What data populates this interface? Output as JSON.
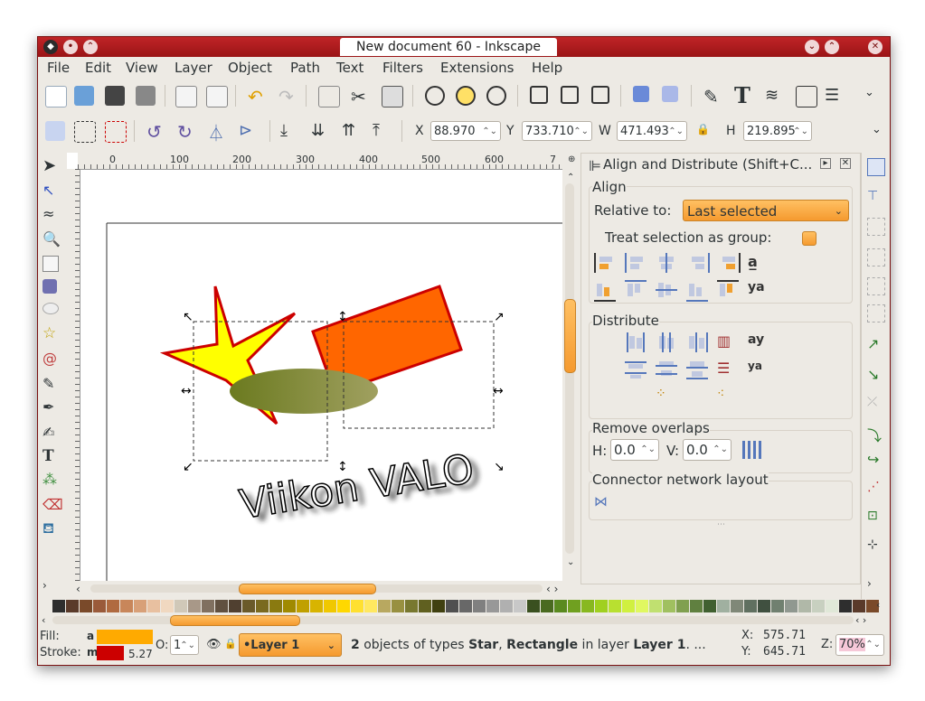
{
  "window": {
    "title": "New document 60 - Inkscape"
  },
  "menu": [
    "File",
    "Edit",
    "View",
    "Layer",
    "Object",
    "Path",
    "Text",
    "Filters",
    "Extensions",
    "Help"
  ],
  "coords_toolbar": {
    "x_label": "X",
    "x_value": "88.970",
    "y_label": "Y",
    "y_value": "733.710",
    "w_label": "W",
    "w_value": "471.493",
    "h_label": "H",
    "h_value": "219.895"
  },
  "ruler": {
    "ticks": [
      "0",
      "100",
      "200",
      "300",
      "400",
      "500",
      "600",
      "7"
    ]
  },
  "canvas": {
    "text_object": "Viikon VALO"
  },
  "dock": {
    "title": "Align and Distribute (Shift+C...",
    "align_header": "Align",
    "relative_label": "Relative to:",
    "relative_value": "Last selected",
    "treat_group_label": "Treat selection as group:",
    "distribute_header": "Distribute",
    "remove_overlaps_header": "Remove overlaps",
    "h_label": "H:",
    "h_value": "0.0",
    "v_label": "V:",
    "v_value": "0.0",
    "connector_header": "Connector network layout"
  },
  "status": {
    "fill_label": "Fill:",
    "fill_value": "a",
    "fill_color": "#ffaa00",
    "stroke_label": "Stroke:",
    "stroke_value": "m",
    "stroke_color": "#cc0000",
    "stroke_width": "5.27",
    "opacity_label": "O:",
    "opacity_value": "1",
    "layer_value": "•Layer 1",
    "message_count": "2",
    "message_part1": " objects of types ",
    "message_type1": "Star",
    "message_part2": ", ",
    "message_type2": "Rectangle",
    "message_part3": " in layer ",
    "message_layer": "Layer 1",
    "message_part4": ". ...",
    "x_label": "X:",
    "x_value": "575.71",
    "y_label": "Y:",
    "y_value": "645.71",
    "zoom_label": "Z:",
    "zoom_value": "70%"
  },
  "colors": {
    "titlebar": "#b01d20",
    "star_fill": "#ffff00",
    "rect_fill": "#ff6600",
    "outline": "#cc0000",
    "ellipse_start": "#6b7a1f",
    "ellipse_end": "#a0a060",
    "accent": "#f59a2f"
  }
}
